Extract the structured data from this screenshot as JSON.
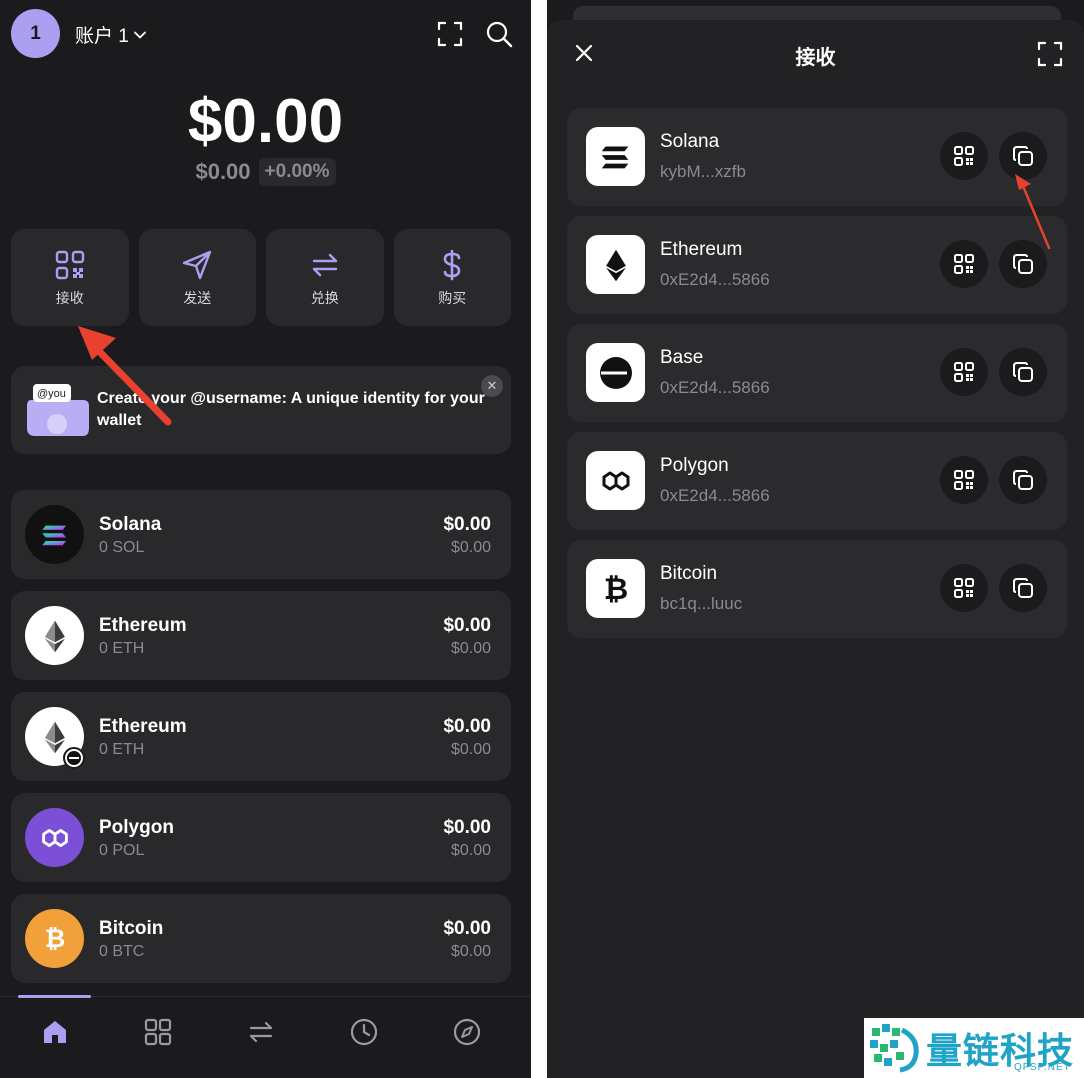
{
  "left": {
    "header": {
      "avatar_text": "1",
      "account_label": "账户 1",
      "icons": [
        "expand-icon",
        "search-icon"
      ]
    },
    "balance": {
      "main": "$0.00",
      "sub": "$0.00",
      "change": "+0.00%"
    },
    "actions": [
      {
        "label": "接收",
        "icon": "qr-icon"
      },
      {
        "label": "发送",
        "icon": "send-icon"
      },
      {
        "label": "兑换",
        "icon": "swap-icon"
      },
      {
        "label": "购买",
        "icon": "dollar-icon"
      }
    ],
    "banner": {
      "art_label": "@you",
      "text": "Create your @username: A unique identity for your wallet",
      "close": "✕"
    },
    "tokens": [
      {
        "name": "Solana",
        "amount": "0 SOL",
        "value": "$0.00",
        "value_sub": "$0.00",
        "icon": "solana-icon",
        "bg": "#111111"
      },
      {
        "name": "Ethereum",
        "amount": "0 ETH",
        "value": "$0.00",
        "value_sub": "$0.00",
        "icon": "ethereum-icon",
        "bg": "#ffffff"
      },
      {
        "name": "Ethereum",
        "amount": "0 ETH",
        "value": "$0.00",
        "value_sub": "$0.00",
        "icon": "ethereum-icon",
        "bg": "#ffffff"
      },
      {
        "name": "Polygon",
        "amount": "0 POL",
        "value": "$0.00",
        "value_sub": "$0.00",
        "icon": "polygon-icon",
        "bg": "#7b4fd6"
      },
      {
        "name": "Bitcoin",
        "amount": "0 BTC",
        "value": "$0.00",
        "value_sub": "$0.00",
        "icon": "bitcoin-icon",
        "bg": "#f2a13a"
      }
    ],
    "nav": [
      "home-icon",
      "grid-icon",
      "swap-icon",
      "history-icon",
      "compass-icon"
    ]
  },
  "right": {
    "title": "接收",
    "rows": [
      {
        "name": "Solana",
        "address": "kybM...xzfb",
        "icon": "solana-icon"
      },
      {
        "name": "Ethereum",
        "address": "0xE2d4...5866",
        "icon": "ethereum-icon"
      },
      {
        "name": "Base",
        "address": "0xE2d4...5866",
        "icon": "base-icon"
      },
      {
        "name": "Polygon",
        "address": "0xE2d4...5866",
        "icon": "polygon-icon"
      },
      {
        "name": "Bitcoin",
        "address": "bc1q...luuc",
        "icon": "bitcoin-icon"
      }
    ]
  },
  "watermark": {
    "cn": "量链科技",
    "en": "QFSP.NET"
  },
  "colors": {
    "accent": "#ab9ff2",
    "bg": "#1b1b1d",
    "card": "#29292c",
    "arrow": "#e8412f"
  }
}
